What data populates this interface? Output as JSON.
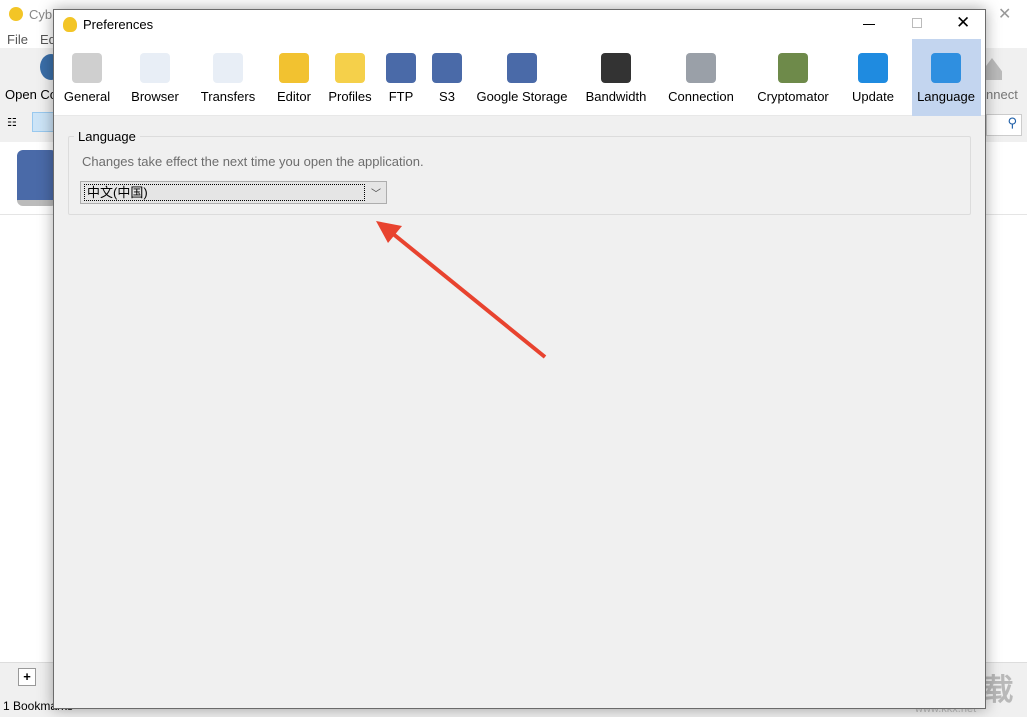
{
  "background_app": {
    "title": "Cyb",
    "menu": [
      "File",
      "Ed"
    ],
    "toolbar": [
      "Open Co",
      "nnect"
    ],
    "status": "1 Bookmarks",
    "add_label": "+"
  },
  "dialog": {
    "title": "Preferences",
    "toolbar": [
      {
        "label": "General",
        "icon": "general-icon",
        "color": "#cfcfcf"
      },
      {
        "label": "Browser",
        "icon": "browser-icon",
        "color": "#e8eef6"
      },
      {
        "label": "Transfers",
        "icon": "transfers-icon",
        "color": "#e8eef6"
      },
      {
        "label": "Editor",
        "icon": "pencil-icon",
        "color": "#f2c230"
      },
      {
        "label": "Profiles",
        "icon": "duck-document-icon",
        "color": "#f5d04a"
      },
      {
        "label": "FTP",
        "icon": "ftp-drive-icon",
        "color": "#4a6aa8"
      },
      {
        "label": "S3",
        "icon": "s3-drive-icon",
        "color": "#4a6aa8"
      },
      {
        "label": "Google Storage",
        "icon": "google-storage-drive-icon",
        "color": "#4a6aa8"
      },
      {
        "label": "Bandwidth",
        "icon": "gauge-icon",
        "color": "#333333"
      },
      {
        "label": "Connection",
        "icon": "network-plug-icon",
        "color": "#9aa0a8"
      },
      {
        "label": "Cryptomator",
        "icon": "robot-icon",
        "color": "#6e8a4a"
      },
      {
        "label": "Update",
        "icon": "refresh-icon",
        "color": "#1f8be0"
      },
      {
        "label": "Language",
        "icon": "flag-icon",
        "color": "#2f8fe0",
        "selected": true
      }
    ],
    "language_group": {
      "label": "Language",
      "hint": "Changes take effect the next time you open the application.",
      "selected": "中文(中国)"
    }
  },
  "watermark": {
    "logo": "KK下载",
    "url": "www.kkx.net"
  }
}
